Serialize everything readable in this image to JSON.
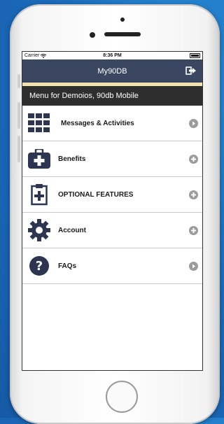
{
  "status_bar": {
    "carrier": "Carrier",
    "time": "8:36 PM"
  },
  "nav": {
    "title": "My90DB",
    "logout_icon": "sign-out-icon"
  },
  "menu_header": "Menu for Demoios, 90db Mobile",
  "menu_items": [
    {
      "label": "Messages & Activities",
      "icon": "grid-icon",
      "action": "chevron-right"
    },
    {
      "label": "Benefits",
      "icon": "medical-kit-icon",
      "action": "plus"
    },
    {
      "label": "OPTIONAL FEATURES",
      "icon": "clipboard-plus-icon",
      "action": "plus"
    },
    {
      "label": "Account",
      "icon": "gear-icon",
      "action": "plus"
    },
    {
      "label": "FAQs",
      "icon": "question-circle-icon",
      "action": "chevron-right"
    }
  ],
  "colors": {
    "navbar": "#3b4660",
    "header": "#2e2e2e",
    "accent_line": "#f2e2ae",
    "icon": "#2d3550",
    "background": "#1d6fc0"
  }
}
